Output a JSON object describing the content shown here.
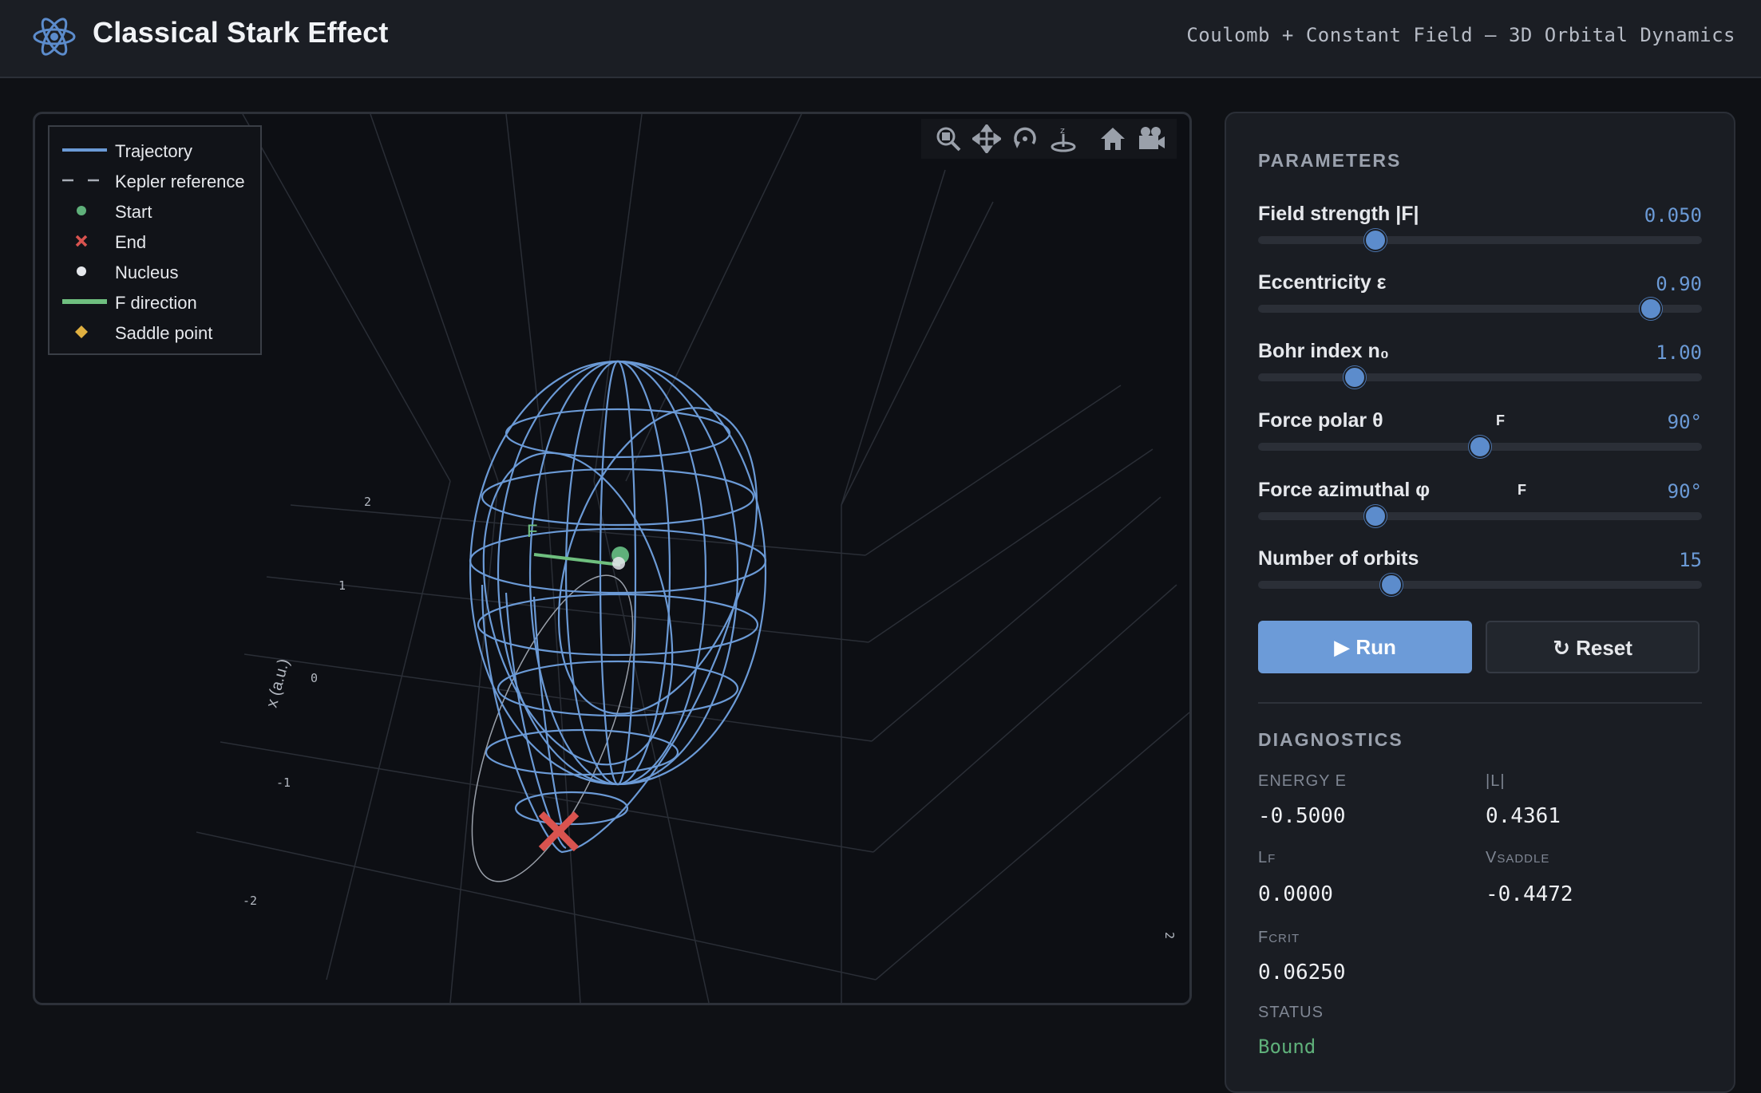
{
  "header": {
    "title": "Classical Stark Effect",
    "subtitle": "Coulomb + Constant Field — 3D Orbital Dynamics",
    "logo_icon": "atom-icon"
  },
  "plot": {
    "legend": [
      {
        "label": "Trajectory",
        "symbol": "solid-line",
        "color": "#6b9ad6"
      },
      {
        "label": "Kepler reference",
        "symbol": "dashed-line",
        "color": "#a8adb6"
      },
      {
        "label": "Start",
        "symbol": "dot",
        "color": "#5fb07a"
      },
      {
        "label": "End",
        "symbol": "x",
        "color": "#d9534f"
      },
      {
        "label": "Nucleus",
        "symbol": "dot",
        "color": "#e6e8ec"
      },
      {
        "label": "F direction",
        "symbol": "thick-line",
        "color": "#6fbf7f"
      },
      {
        "label": "Saddle point",
        "symbol": "diamond",
        "color": "#e0b040"
      }
    ],
    "axis_title": "x (a.u.)",
    "axis_ticks": [
      "2",
      "1",
      "0",
      "-1",
      "-2"
    ],
    "side_tick": "2",
    "force_label": "F",
    "modebar": [
      "zoom-icon",
      "pan-icon",
      "orbit-rotation-icon",
      "turntable-rotation-icon",
      "home-icon",
      "camera-icon"
    ]
  },
  "parameters": {
    "title": "PARAMETERS",
    "items": [
      {
        "label": "Field strength |F|",
        "value": "0.050",
        "fraction": 0.265
      },
      {
        "label": "Eccentricity ε",
        "value": "0.90",
        "fraction": 0.885
      },
      {
        "label": "Bohr index n₀",
        "value": "1.00",
        "fraction": 0.218
      },
      {
        "label": "Force polar θ",
        "value": "90°",
        "fraction": 0.5,
        "marker": "F"
      },
      {
        "label": "Force azimuthal φ",
        "value": "90°",
        "fraction": 0.265,
        "marker": "F"
      },
      {
        "label": "Number of orbits",
        "value": "15",
        "fraction": 0.3
      }
    ],
    "run_label": "▶ Run",
    "reset_label": "↻ Reset"
  },
  "diagnostics": {
    "title": "DIAGNOSTICS",
    "energy_label": "ENERGY E",
    "energy": "-0.5000",
    "l_label": "|L|",
    "l": "0.4361",
    "lf_label": "L",
    "lf_sub": "F",
    "lf": "0.0000",
    "vsaddle_label": "V",
    "vsaddle_sub": "SADDLE",
    "vsaddle": "-0.4472",
    "fcrit_label": "F",
    "fcrit_sub": "CRIT",
    "fcrit": "0.06250",
    "status_label": "STATUS",
    "status": "Bound",
    "status_color": "#5fb07a"
  }
}
